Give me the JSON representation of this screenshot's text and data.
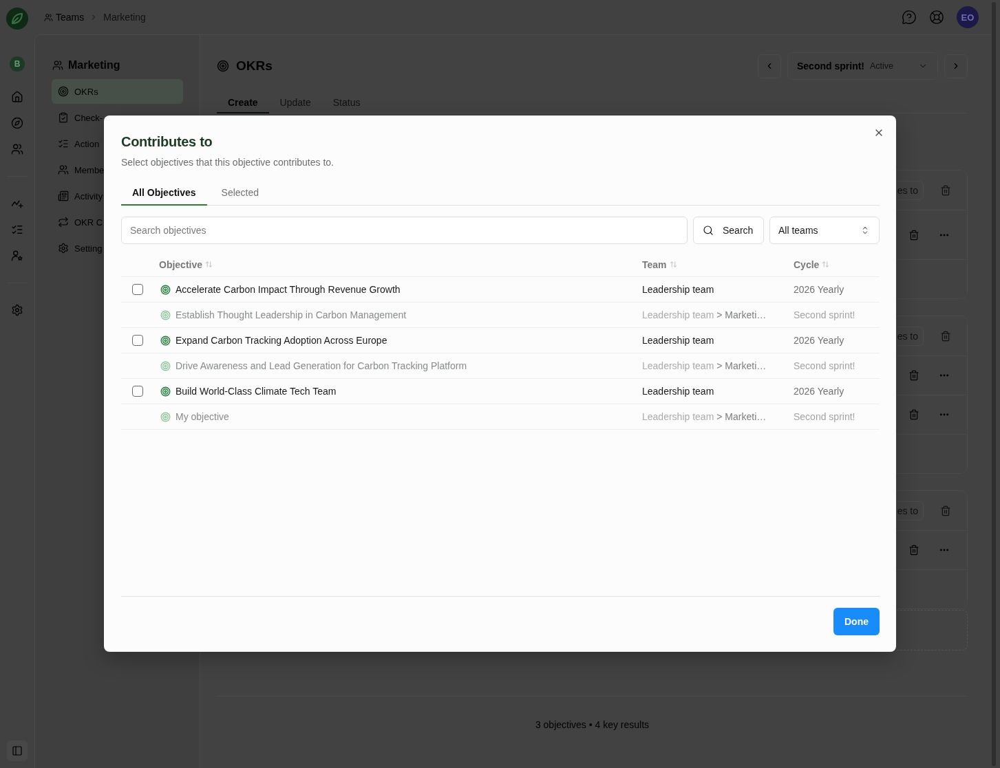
{
  "topbar": {
    "breadcrumb": [
      {
        "label": "Teams",
        "current": false
      },
      {
        "label": "Marketing",
        "current": true
      }
    ],
    "avatar": "EO"
  },
  "rail": {
    "workspace": "B"
  },
  "sidebar": {
    "title": "Marketing",
    "items": [
      {
        "label": "OKRs",
        "selected": true
      },
      {
        "label": "Check-",
        "selected": false
      },
      {
        "label": "Action",
        "selected": false
      },
      {
        "label": "Membe",
        "selected": false
      },
      {
        "label": "Activity",
        "selected": false
      },
      {
        "label": "OKR C",
        "selected": false
      },
      {
        "label": "Setting",
        "selected": false
      }
    ]
  },
  "main": {
    "title": "OKRs",
    "cycle": {
      "name": "Second sprint!",
      "status": "Active"
    },
    "tabs": [
      {
        "label": "Create",
        "selected": true
      },
      {
        "label": "Update",
        "selected": false
      },
      {
        "label": "Status",
        "selected": false
      }
    ],
    "objectives": [
      {
        "button": "es to",
        "key_results": [
          {
            "actions": true
          }
        ]
      },
      {
        "button": "es to",
        "key_results": [
          {
            "actions": true
          },
          {
            "actions": true
          }
        ]
      },
      {
        "button": "es to",
        "key_results": [
          {
            "actions": true
          }
        ]
      }
    ],
    "summary": "3 objectives • 4 key results"
  },
  "dialog": {
    "title": "Contributes to",
    "subtitle": "Select objectives that this objective contributes to.",
    "tabs": [
      {
        "label": "All Objectives",
        "selected": true
      },
      {
        "label": "Selected",
        "selected": false
      }
    ],
    "search": {
      "placeholder": "Search objectives",
      "button": "Search"
    },
    "team_filter": {
      "value": "All teams"
    },
    "table": {
      "columns": [
        "Objective",
        "Team",
        "Cycle"
      ],
      "rows": [
        {
          "objective": "Accelerate Carbon Impact Through Revenue Growth",
          "team": "Leadership team",
          "cycle": "2026 Yearly",
          "disabled": false,
          "checked": false
        },
        {
          "objective": "Establish Thought Leadership in Carbon Management",
          "parent_team": "Leadership team",
          "team": "> Marketi…",
          "cycle": "Second sprint!",
          "disabled": true,
          "checked": false
        },
        {
          "objective": "Expand Carbon Tracking Adoption Across Europe",
          "team": "Leadership team",
          "cycle": "2026 Yearly",
          "disabled": false,
          "checked": false
        },
        {
          "objective": "Drive Awareness and Lead Generation for Carbon Tracking Platform",
          "parent_team": "Leadership team",
          "team": "> Marketi…",
          "cycle": "Second sprint!",
          "disabled": true,
          "checked": false
        },
        {
          "objective": "Build World-Class Climate Tech Team",
          "team": "Leadership team",
          "cycle": "2026 Yearly",
          "disabled": false,
          "checked": false
        },
        {
          "objective": "My objective",
          "parent_team": "Leadership team",
          "team": "> Marketi…",
          "cycle": "Second sprint!",
          "disabled": true,
          "checked": false
        }
      ]
    },
    "done_button": "Done"
  }
}
